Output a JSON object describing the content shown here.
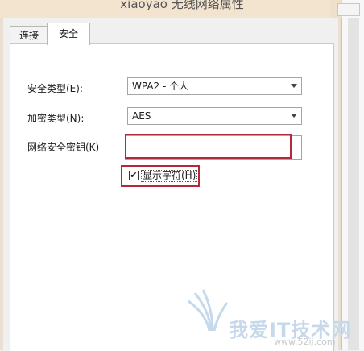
{
  "window": {
    "title": "xiaoyao 无线网络属性"
  },
  "tabs": [
    {
      "label": "连接"
    },
    {
      "label": "安全"
    }
  ],
  "security_type": {
    "label": "安全类型(E):",
    "value": "WPA2 - 个人"
  },
  "encryption_type": {
    "label": "加密类型(N):",
    "value": "AES"
  },
  "network_key": {
    "label": "网络安全密钥(K)",
    "value": ""
  },
  "show_characters": {
    "label": "显示字符(H)",
    "checked": true,
    "check_glyph": "✔"
  },
  "watermark": {
    "text": "我爱IT技术网",
    "url": "www.52ij.com"
  },
  "colors": {
    "highlight": "#b3283a",
    "title_bar": "#f3e4cf"
  }
}
